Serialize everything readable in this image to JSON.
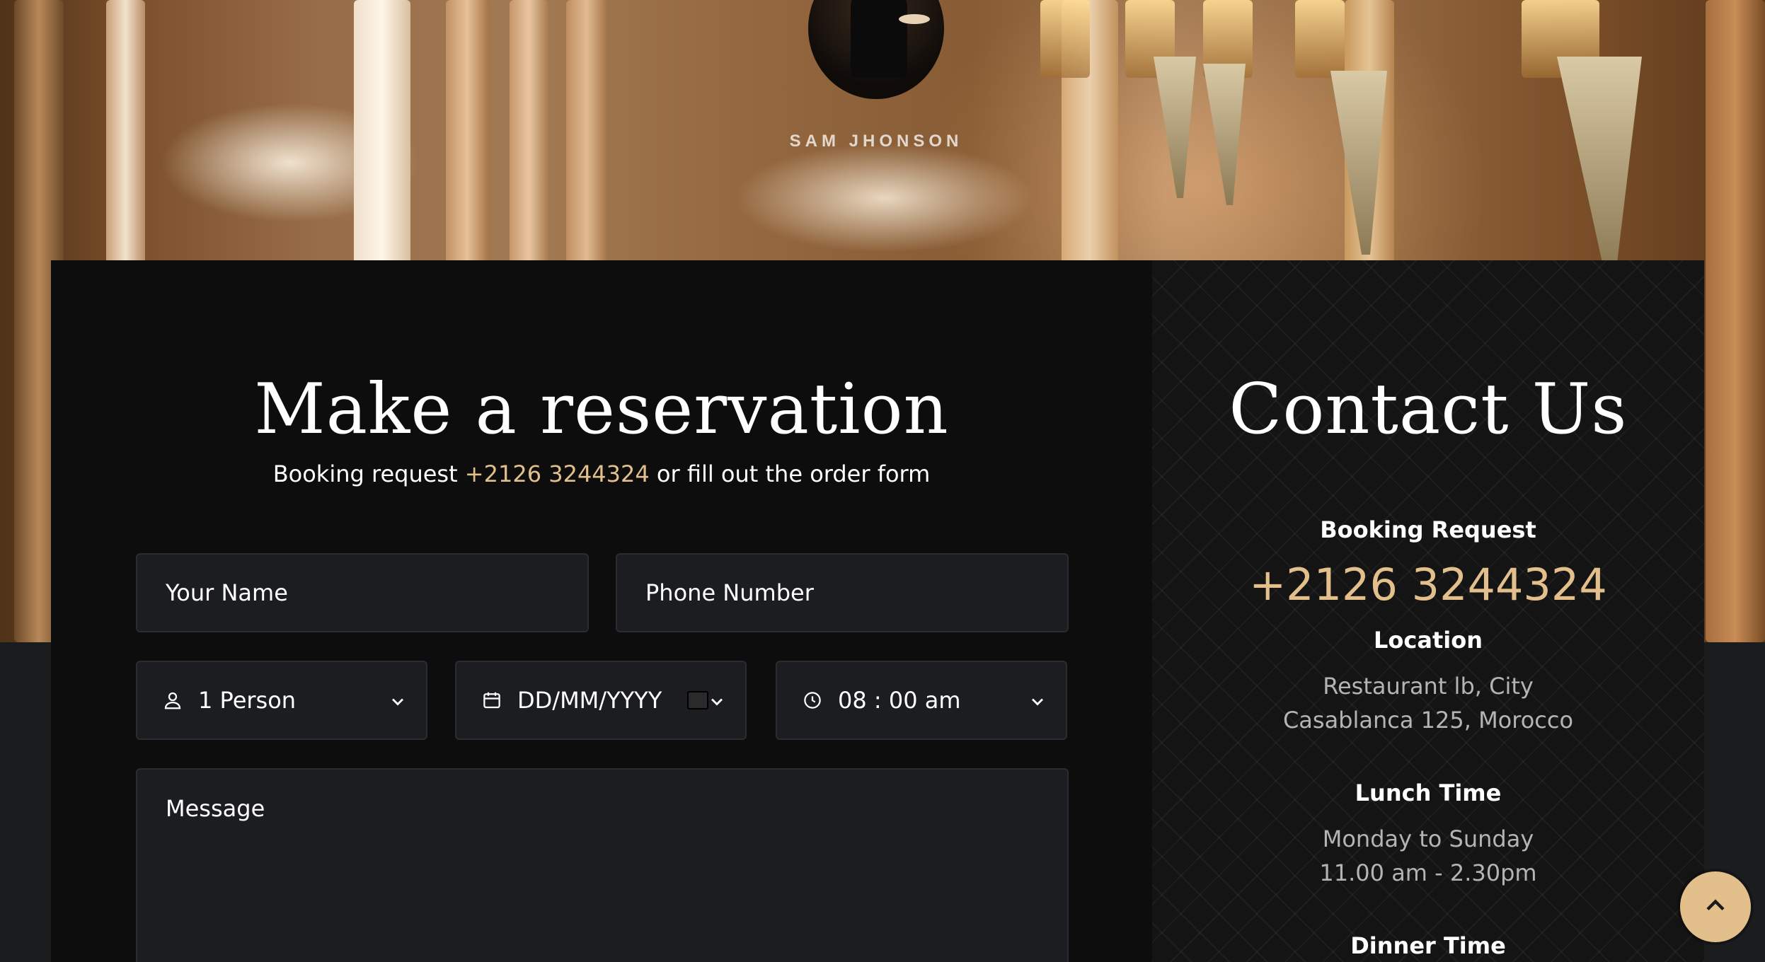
{
  "chef": {
    "name": "SAM JHONSON"
  },
  "reservation": {
    "title": "Make a reservation",
    "subtitle_prefix": "Booking request",
    "phone": "+2126 3244324",
    "subtitle_suffix": "or fill out the order form",
    "fields": {
      "name_placeholder": "Your Name",
      "phone_placeholder": "Phone Number",
      "person_value": "1 Person",
      "date_placeholder": "DD/MM/YYYY",
      "time_value": "08 : 00 am",
      "message_placeholder": "Message"
    }
  },
  "contact": {
    "title": "Contact Us",
    "booking_label": "Booking Request",
    "booking_phone": "+2126 3244324",
    "location_label": "Location",
    "location_line1": "Restaurant lb, City",
    "location_line2": "Casablanca 125, Morocco",
    "lunch_label": "Lunch Time",
    "lunch_line1": "Monday to Sunday",
    "lunch_line2": "11.00 am - 2.30pm",
    "dinner_label": "Dinner Time"
  },
  "icons": {
    "person": "user-icon",
    "date": "calendar-icon",
    "time": "clock-icon",
    "chevron": "chevron-down-icon",
    "scroll_top": "chevron-up-icon"
  },
  "colors": {
    "accent_gold": "#e3c08b",
    "panel_bg": "#0d0d0d",
    "field_bg": "#1b1d20",
    "page_bg": "#1a1c1e"
  }
}
